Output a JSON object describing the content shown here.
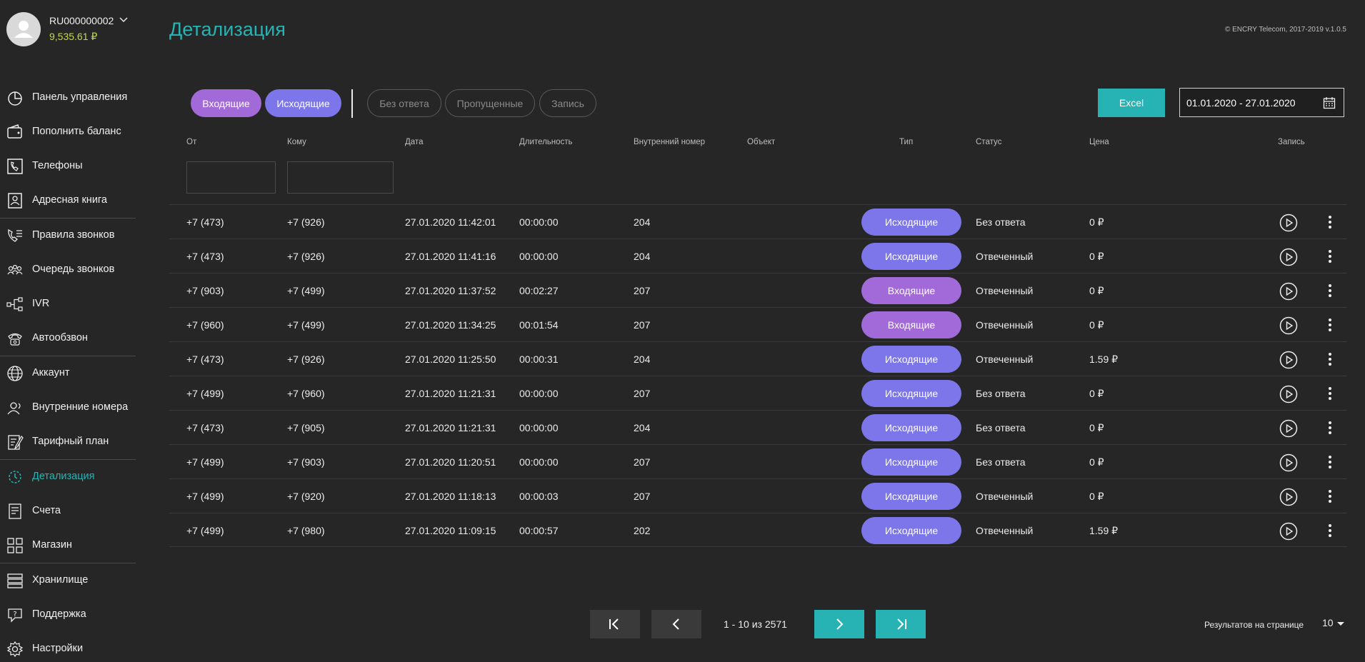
{
  "account": {
    "id": "RU000000002",
    "balance": "9,535.61 ₽"
  },
  "sidebar": {
    "items": [
      {
        "label": "Панель управления",
        "icon": "dashboard-pie-icon"
      },
      {
        "label": "Пополнить баланс",
        "icon": "wallet-icon"
      },
      {
        "label": "Телефоны",
        "icon": "phone-icon"
      },
      {
        "label": "Адресная книга",
        "icon": "address-book-icon"
      },
      {
        "label": "Правила звонков",
        "icon": "call-rules-icon"
      },
      {
        "label": "Очередь звонков",
        "icon": "call-queue-icon"
      },
      {
        "label": "IVR",
        "icon": "ivr-tree-icon"
      },
      {
        "label": "Автообзвон",
        "icon": "autodialer-icon"
      },
      {
        "label": "Аккаунт",
        "icon": "globe-icon"
      },
      {
        "label": "Внутренние номера",
        "icon": "extensions-icon"
      },
      {
        "label": "Тарифный план",
        "icon": "tariff-icon"
      },
      {
        "label": "Детализация",
        "icon": "details-icon",
        "active": true
      },
      {
        "label": "Счета",
        "icon": "invoice-icon"
      },
      {
        "label": "Магазин",
        "icon": "store-grid-icon"
      },
      {
        "label": "Хранилище",
        "icon": "storage-icon"
      },
      {
        "label": "Поддержка",
        "icon": "support-icon"
      },
      {
        "label": "Настройки",
        "icon": "gear-icon"
      }
    ]
  },
  "header": {
    "title": "Детализация",
    "copyright": "© ENCRY Telecom, 2017-2019 v.1.0.5"
  },
  "filters": {
    "incoming": "Входящие",
    "outgoing": "Исходящие",
    "no_answer": "Без ответа",
    "missed": "Пропущенные",
    "record": "Запись"
  },
  "excel_label": "Excel",
  "date_range": "01.01.2020 - 27.01.2020",
  "table": {
    "columns": [
      "От",
      "Кому",
      "Дата",
      "Длительность",
      "Внутренний номер",
      "Объект",
      "Тип",
      "Статус",
      "Цена",
      "Запись"
    ],
    "rows": [
      {
        "from": "+7 (473)",
        "to": "+7 (926)",
        "date": "27.01.2020 11:42:01",
        "duration": "00:00:00",
        "ext": "204",
        "object": "",
        "type": "Исходящие",
        "type_kind": "out",
        "status": "Без ответа",
        "price": "0 ₽"
      },
      {
        "from": "+7 (473)",
        "to": "+7 (926)",
        "date": "27.01.2020 11:41:16",
        "duration": "00:00:00",
        "ext": "204",
        "object": "",
        "type": "Исходящие",
        "type_kind": "out",
        "status": "Отвеченный",
        "price": "0 ₽"
      },
      {
        "from": "+7 (903)",
        "to": "+7 (499)",
        "date": "27.01.2020 11:37:52",
        "duration": "00:02:27",
        "ext": "207",
        "object": "",
        "type": "Входящие",
        "type_kind": "in",
        "status": "Отвеченный",
        "price": "0 ₽"
      },
      {
        "from": "+7 (960)",
        "to": "+7 (499)",
        "date": "27.01.2020 11:34:25",
        "duration": "00:01:54",
        "ext": "207",
        "object": "",
        "type": "Входящие",
        "type_kind": "in",
        "status": "Отвеченный",
        "price": "0 ₽"
      },
      {
        "from": "+7 (473)",
        "to": "+7 (926)",
        "date": "27.01.2020 11:25:50",
        "duration": "00:00:31",
        "ext": "204",
        "object": "",
        "type": "Исходящие",
        "type_kind": "out",
        "status": "Отвеченный",
        "price": "1.59 ₽"
      },
      {
        "from": "+7 (499)",
        "to": "+7 (960)",
        "date": "27.01.2020 11:21:31",
        "duration": "00:00:00",
        "ext": "207",
        "object": "",
        "type": "Исходящие",
        "type_kind": "out",
        "status": "Без ответа",
        "price": "0 ₽"
      },
      {
        "from": "+7 (473)",
        "to": "+7 (905)",
        "date": "27.01.2020 11:21:31",
        "duration": "00:00:00",
        "ext": "204",
        "object": "",
        "type": "Исходящие",
        "type_kind": "out",
        "status": "Без ответа",
        "price": "0 ₽"
      },
      {
        "from": "+7 (499)",
        "to": "+7 (903)",
        "date": "27.01.2020 11:20:51",
        "duration": "00:00:00",
        "ext": "207",
        "object": "",
        "type": "Исходящие",
        "type_kind": "out",
        "status": "Без ответа",
        "price": "0 ₽"
      },
      {
        "from": "+7 (499)",
        "to": "+7 (920)",
        "date": "27.01.2020 11:18:13",
        "duration": "00:00:03",
        "ext": "207",
        "object": "",
        "type": "Исходящие",
        "type_kind": "out",
        "status": "Отвеченный",
        "price": "0 ₽"
      },
      {
        "from": "+7 (499)",
        "to": "+7 (980)",
        "date": "27.01.2020 11:09:15",
        "duration": "00:00:57",
        "ext": "202",
        "object": "",
        "type": "Исходящие",
        "type_kind": "out",
        "status": "Отвеченный",
        "price": "1.59 ₽"
      }
    ]
  },
  "pagination": {
    "range_text": "1 - 10 из 2571",
    "per_page_label": "Результатов на странице",
    "per_page": "10"
  },
  "colors": {
    "accent": "#27b3b3",
    "incoming": "#a26ad8",
    "outgoing": "#7c76ea",
    "balance": "#c6d94a",
    "background": "#262626"
  }
}
